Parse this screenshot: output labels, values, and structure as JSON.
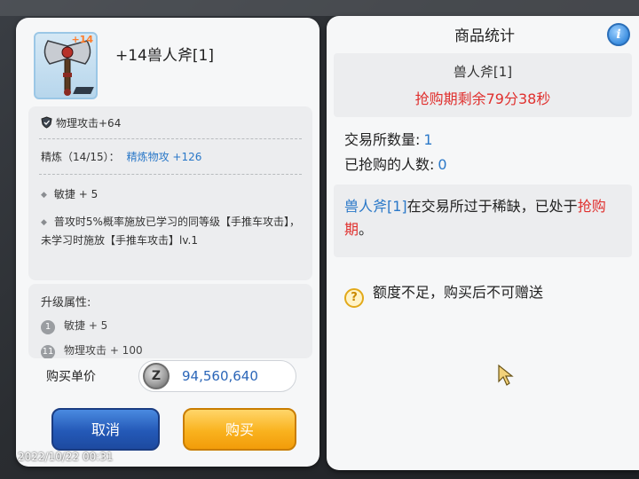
{
  "item": {
    "plus_badge": "+14",
    "title": "+14兽人斧[1]"
  },
  "stats": {
    "phys_attack": "物理攻击+64",
    "refine_label": "精炼（14/15）：",
    "refine_value": "精炼物攻 +126",
    "attr1": "敏捷 + 5",
    "desc": "普攻时5%概率施放已学习的同等级【手推车攻击】，未学习时施放【手推车攻击】lv.1"
  },
  "upgrade": {
    "title": "升级属性:",
    "rows": [
      {
        "num": "1",
        "text": "敏捷 + 5"
      },
      {
        "num": "11",
        "text": "物理攻击 + 100"
      }
    ]
  },
  "price": {
    "label": "购买单价",
    "coin": "Z",
    "value": "94,560,640"
  },
  "buttons": {
    "cancel": "取消",
    "buy": "购买"
  },
  "right": {
    "title": "商品统计",
    "info": "i",
    "item_name": "兽人斧[1]",
    "countdown": "抢购期剩余79分38秒",
    "exchange_count_label": "交易所数量:",
    "exchange_count": "1",
    "buyers_label": "已抢购的人数:",
    "buyers": "0",
    "notice_item": "兽人斧[1]",
    "notice_mid": "在交易所过于稀缺，已处于",
    "notice_red": "抢购期",
    "notice_end": "。",
    "warn_icon": "?",
    "warn": "额度不足，购买后不可赠送"
  },
  "photo": {
    "timestamp": "2022/10/22 00:31"
  },
  "colors": {
    "accent_blue": "#2a78c8",
    "alert_red": "#e0302e",
    "buy_orange": "#f9b21e",
    "cancel_blue": "#2459b7"
  }
}
